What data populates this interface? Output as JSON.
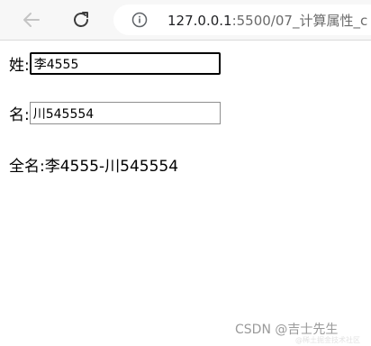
{
  "browser": {
    "url_host": "127.0.0.1",
    "url_path": ":5500/07_计算属性_c"
  },
  "form": {
    "last_name_label": "姓:",
    "last_name_value": "李4555",
    "first_name_label": "名:",
    "first_name_value": "川545554",
    "full_name_label": "全名:",
    "full_name_value": "李4555-川545554"
  },
  "watermark": {
    "text": "CSDN @吉士先生",
    "faint_text": "@稀土掘金技术社区"
  },
  "colors": {
    "toolbar_bg": "#f7f7f7",
    "focused_border": "#000000"
  },
  "icons": {
    "back": "arrow-left",
    "reload": "circular-arrow",
    "info": "info-circle"
  }
}
